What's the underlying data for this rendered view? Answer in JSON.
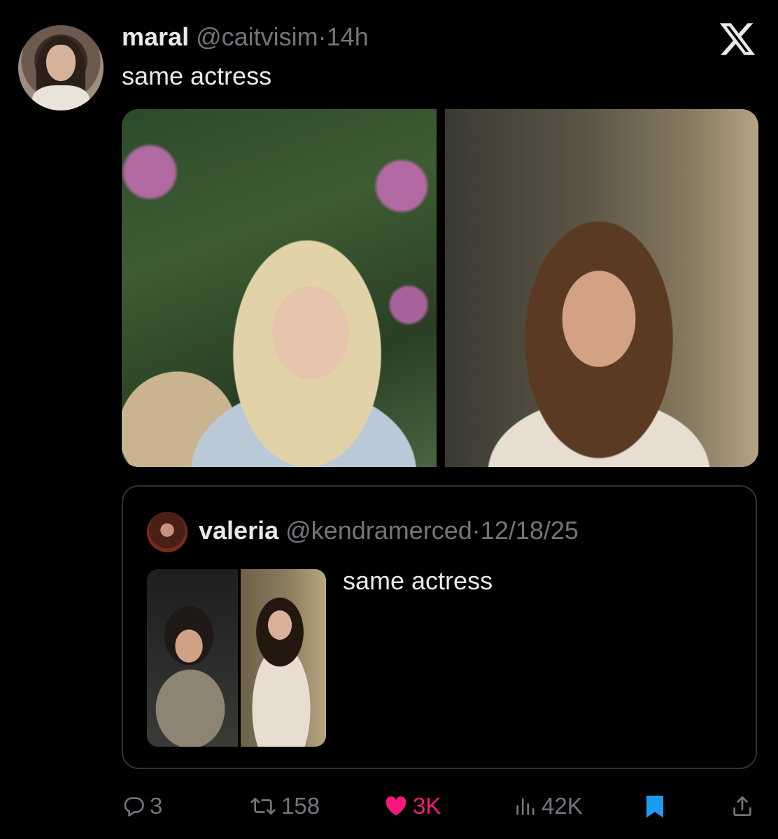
{
  "tweet": {
    "author_name": "maral",
    "author_handle": "@caitvisim",
    "separator": "·",
    "time": "14h",
    "text": "same actress"
  },
  "quoted_tweet": {
    "author_name": "valeria",
    "author_handle": "@kendramerced",
    "separator": "·",
    "date": "12/18/25",
    "text": "same actress"
  },
  "actions": {
    "replies": "3",
    "retweets": "158",
    "likes": "3K",
    "views": "42K"
  },
  "icons": {
    "logo": "x-logo-icon",
    "reply": "reply-icon",
    "retweet": "retweet-icon",
    "like": "heart-icon",
    "views": "views-icon",
    "bookmark": "bookmark-icon",
    "share": "share-icon"
  },
  "colors": {
    "background": "#000000",
    "primary_text": "#e7e9ea",
    "secondary_text": "#71767b",
    "like": "#f91880",
    "bookmark": "#1d9bf0",
    "border": "#2f3336"
  }
}
